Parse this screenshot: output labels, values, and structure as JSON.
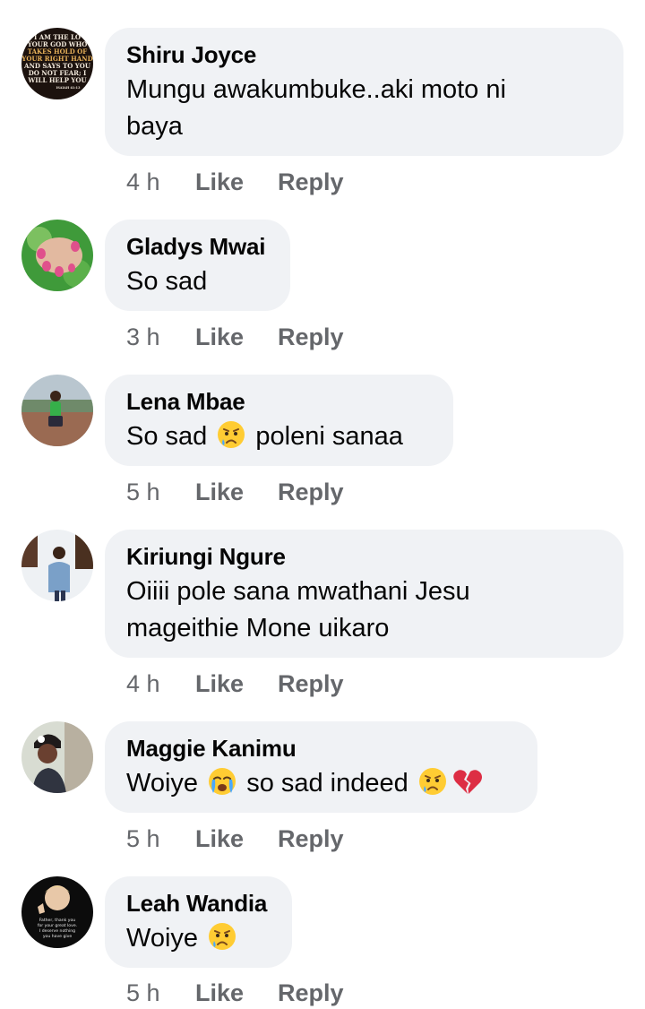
{
  "comments": [
    {
      "author": "Shiru Joyce",
      "text_lines": [
        "Mungu awakumbuke..aki moto ni",
        "baya"
      ],
      "time": "4 h",
      "like": "Like",
      "reply": "Reply",
      "avatar": {
        "type": "scripture-text-image",
        "lines": [
          "I AM THE LO",
          "YOUR GOD WHO",
          "TAKES HOLD OF",
          "YOUR RIGHT HAND",
          "AND SAYS TO YOU",
          "DO NOT FEAR; I",
          "WILL HELP YOU",
          "ISAIAH 41:13"
        ]
      }
    },
    {
      "author": "Gladys Mwai",
      "text": "So sad",
      "time": "3 h",
      "like": "Like",
      "reply": "Reply",
      "avatar": {
        "type": "manicured-nails-photo"
      }
    },
    {
      "author": "Lena Mbae",
      "text_before": "So sad",
      "emoji": "crying-face",
      "text_after": "poleni sanaa",
      "time": "5 h",
      "like": "Like",
      "reply": "Reply",
      "avatar": {
        "type": "person-photo"
      }
    },
    {
      "author": "Kiriungi Ngure",
      "text_lines": [
        "Oiiii pole sana mwathani Jesu",
        "mageithie Mone uikaro"
      ],
      "time": "4 h",
      "like": "Like",
      "reply": "Reply",
      "avatar": {
        "type": "person-photo"
      }
    },
    {
      "author": "Maggie Kanimu",
      "text_before": "Woiye",
      "emoji": "loudly-crying-face",
      "text_after": "so sad indeed",
      "trailing_emojis": [
        "crying-face",
        "broken-heart"
      ],
      "time": "5 h",
      "like": "Like",
      "reply": "Reply",
      "avatar": {
        "type": "person-photo"
      }
    },
    {
      "author": "Leah Wandia",
      "text_before": "Woiye",
      "emoji": "crying-face",
      "time": "5 h",
      "like": "Like",
      "reply": "Reply",
      "avatar": {
        "type": "child-photo-with-caption",
        "lines": [
          "Father, thank you",
          "for your great love.",
          "I deserve nothing",
          "you have give"
        ]
      }
    }
  ]
}
